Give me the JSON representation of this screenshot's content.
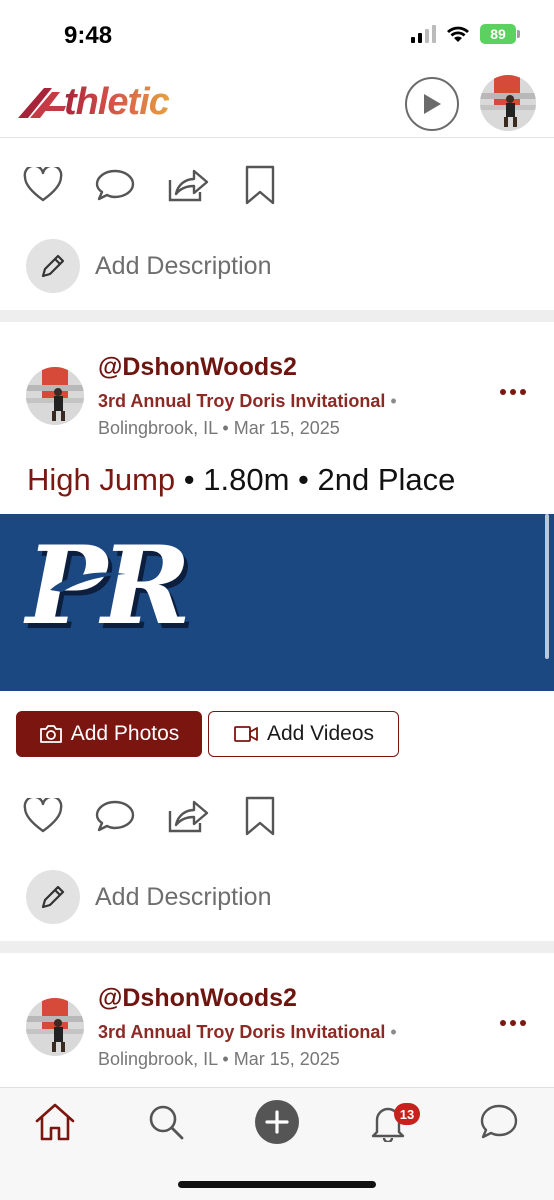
{
  "status_bar": {
    "time": "9:48",
    "battery": "89"
  },
  "app": {
    "logo_text": "thletic",
    "brand_color": "#7a1510",
    "banner_color": "#1c4882"
  },
  "header": {
    "play_icon": "play-circle-icon",
    "avatar_icon": "profile-avatar"
  },
  "feed": {
    "top_card": {
      "description_placeholder": "Add Description"
    },
    "posts": [
      {
        "username": "@DshonWoods2",
        "meet": "3rd Annual Troy Doris Invitational",
        "meet_separator": "•",
        "location": "Bolingbrook, IL • Mar 15, 2025",
        "event": "High Jump",
        "result": " • 1.80m • 2nd Place",
        "banner_text": "PR",
        "add_photos_label": "Add Photos",
        "add_videos_label": "Add Videos",
        "description_placeholder": "Add Description"
      },
      {
        "username": "@DshonWoods2",
        "meet": "3rd Annual Troy Doris Invitational",
        "meet_separator": "•",
        "location": "Bolingbrook, IL • Mar 15, 2025"
      }
    ]
  },
  "tab_bar": {
    "items": [
      "home-icon",
      "search-icon",
      "add-icon",
      "notifications-icon",
      "messages-icon"
    ],
    "notification_count": "13"
  }
}
